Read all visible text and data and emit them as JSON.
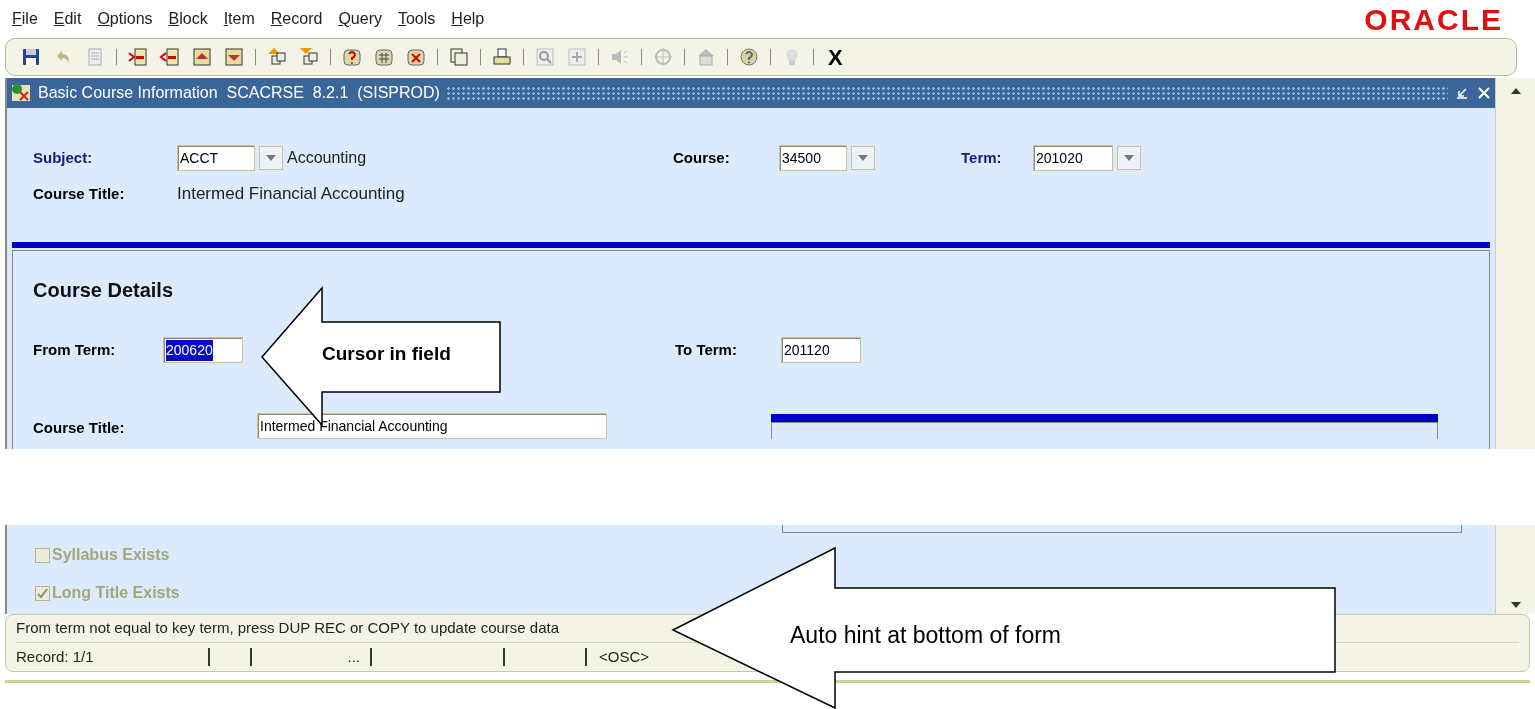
{
  "menu": [
    "File",
    "Edit",
    "Options",
    "Block",
    "Item",
    "Record",
    "Query",
    "Tools",
    "Help"
  ],
  "logo": {
    "text": "ORACLE"
  },
  "toolbar": {
    "exit_label": "X"
  },
  "window": {
    "title": "Basic Course Information  SCACRSE  8.2.1  (SISPROD)"
  },
  "key_block": {
    "subject": {
      "label": "Subject:",
      "value": "ACCT",
      "description": "Accounting",
      "required": true
    },
    "course": {
      "label": "Course:",
      "value": "34500",
      "required": false
    },
    "term": {
      "label": "Term:",
      "value": "201020",
      "required": true
    },
    "course_title": {
      "label": "Course Title:",
      "value": "Intermed Financial Accounting"
    }
  },
  "details": {
    "heading": "Course Details",
    "from_term": {
      "label": "From Term:",
      "value": "200620",
      "highlighted": true
    },
    "to_term": {
      "label": "To Term:",
      "value": "201120",
      "highlighted": false
    },
    "course_title": {
      "label": "Course Title:",
      "value": "Intermed Financial Accounting"
    },
    "checkboxes": [
      {
        "label": "Syllabus Exists",
        "checked": false,
        "disabled": true
      },
      {
        "label": "Long Title Exists",
        "checked": true,
        "disabled": true
      }
    ]
  },
  "status_bar": {
    "message": "From term not equal to key term, press DUP REC or COPY to update course data",
    "record": "Record: 1/1",
    "ellipsis": "...",
    "mode": "<OSC>"
  },
  "callouts": [
    {
      "text": "Cursor in field"
    },
    {
      "text": "Auto hint at bottom of form"
    }
  ]
}
